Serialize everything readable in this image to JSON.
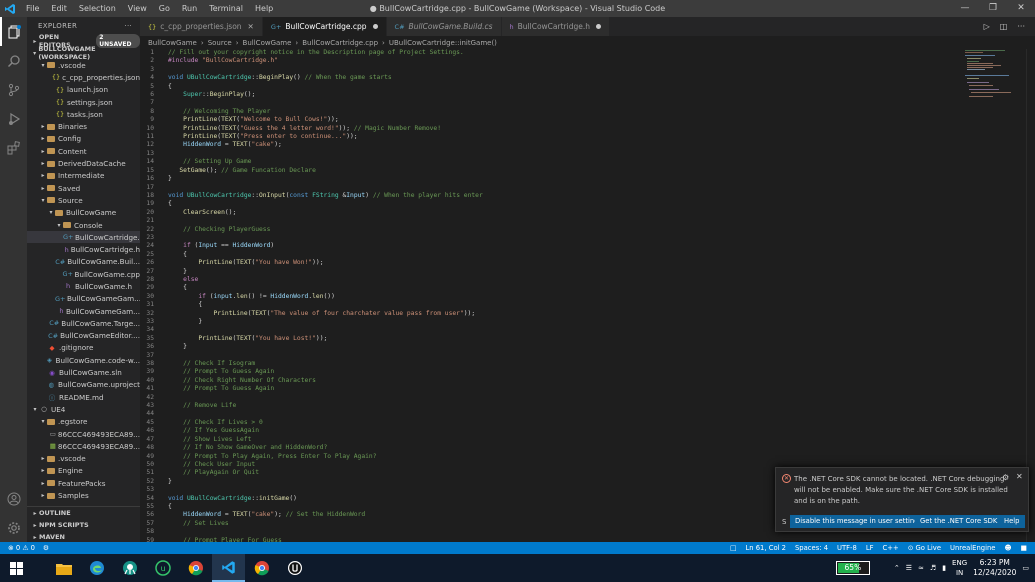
{
  "titlebar": {
    "menu": [
      "File",
      "Edit",
      "Selection",
      "View",
      "Go",
      "Run",
      "Terminal",
      "Help"
    ],
    "title": "● BullCowCartridge.cpp - BullCowGame (Workspace) - Visual Studio Code"
  },
  "sidebar": {
    "header": "EXPLORER",
    "open_editors": "OPEN EDITORS",
    "unsaved": "2 UNSAVED",
    "workspace": "BULLCOWGAME (WORKSPACE)",
    "outline": "OUTLINE",
    "npm": "NPM SCRIPTS",
    "maven": "MAVEN",
    "tree": [
      {
        "label": ".vscode",
        "depth": 1,
        "type": "folder",
        "open": true
      },
      {
        "label": "c_cpp_properties.json",
        "depth": 2,
        "type": "json"
      },
      {
        "label": "launch.json",
        "depth": 2,
        "type": "json"
      },
      {
        "label": "settings.json",
        "depth": 2,
        "type": "json"
      },
      {
        "label": "tasks.json",
        "depth": 2,
        "type": "json"
      },
      {
        "label": "Binaries",
        "depth": 1,
        "type": "folder"
      },
      {
        "label": "Config",
        "depth": 1,
        "type": "folder"
      },
      {
        "label": "Content",
        "depth": 1,
        "type": "folder"
      },
      {
        "label": "DerivedDataCache",
        "depth": 1,
        "type": "folder"
      },
      {
        "label": "Intermediate",
        "depth": 1,
        "type": "folder"
      },
      {
        "label": "Saved",
        "depth": 1,
        "type": "folder"
      },
      {
        "label": "Source",
        "depth": 1,
        "type": "folder",
        "open": true
      },
      {
        "label": "BullCowGame",
        "depth": 2,
        "type": "folder",
        "open": true
      },
      {
        "label": "Console",
        "depth": 3,
        "type": "folder",
        "open": true
      },
      {
        "label": "BullCowCartridge.c...",
        "depth": 4,
        "type": "cpp",
        "selected": true
      },
      {
        "label": "BullCowCartridge.h",
        "depth": 4,
        "type": "h"
      },
      {
        "label": "BullCowGame.Buil...",
        "depth": 3,
        "type": "cs"
      },
      {
        "label": "BullCowGame.cpp",
        "depth": 3,
        "type": "cpp"
      },
      {
        "label": "BullCowGame.h",
        "depth": 3,
        "type": "h"
      },
      {
        "label": "BullCowGameGam...",
        "depth": 3,
        "type": "cpp"
      },
      {
        "label": "BullCowGameGam...",
        "depth": 3,
        "type": "h"
      },
      {
        "label": "BullCowGame.Targe...",
        "depth": 2,
        "type": "cs"
      },
      {
        "label": "BullCowGameEditor....",
        "depth": 2,
        "type": "cs"
      },
      {
        "label": ".gitignore",
        "depth": 1,
        "type": "git"
      },
      {
        "label": "BullCowGame.code-w...",
        "depth": 1,
        "type": "ws"
      },
      {
        "label": "BullCowGame.sln",
        "depth": 1,
        "type": "sln"
      },
      {
        "label": "BullCowGame.uproject",
        "depth": 1,
        "type": "uproj"
      },
      {
        "label": "README.md",
        "depth": 1,
        "type": "md"
      },
      {
        "label": "UE4",
        "depth": 0,
        "type": "root",
        "open": true
      },
      {
        "label": ".egstore",
        "depth": 1,
        "type": "folder",
        "open": true
      },
      {
        "label": "86CCC469493ECA89...",
        "depth": 2,
        "type": "file"
      },
      {
        "label": "86CCC469493ECA89...",
        "depth": 2,
        "type": "filegreen"
      },
      {
        "label": ".vscode",
        "depth": 1,
        "type": "folder"
      },
      {
        "label": "Engine",
        "depth": 1,
        "type": "folder"
      },
      {
        "label": "FeaturePacks",
        "depth": 1,
        "type": "folder"
      },
      {
        "label": "Samples",
        "depth": 1,
        "type": "folder"
      }
    ]
  },
  "tabs": [
    {
      "label": "c_cpp_properties.json",
      "icon": "{}",
      "icon_color": "#cbcb41",
      "state": "close"
    },
    {
      "label": "BullCowCartridge.cpp",
      "icon": "G+",
      "icon_color": "#519aba",
      "state": "dirty",
      "active": true
    },
    {
      "label": "BullCowGame.Build.cs",
      "icon": "C#",
      "icon_color": "#519aba",
      "state": "none",
      "italic": true
    },
    {
      "label": "BullCowCartridge.h",
      "icon": "h",
      "icon_color": "#a074c4",
      "state": "dirty"
    }
  ],
  "breadcrumb": [
    "BullCowGame",
    "Source",
    "BullCowGame",
    "BullCowCartridge.cpp",
    "UBullCowCartridge::initGame()"
  ],
  "code": [
    [
      [
        "c-cm",
        "// Fill out your copyright notice in the Description page of Project Settings."
      ]
    ],
    [
      [
        "c-pp",
        "#include "
      ],
      [
        "c-st",
        "\"BullCowCartridge.h\""
      ]
    ],
    [],
    [
      [
        "c-kw",
        "void "
      ],
      [
        "c-ty",
        "UBullCowCartridge"
      ],
      [
        "",
        "::"
      ],
      [
        "c-fn",
        "BeginPlay"
      ],
      [
        "",
        "() "
      ],
      [
        "c-cm",
        "// When the game starts"
      ]
    ],
    [
      [
        "",
        "{"
      ]
    ],
    [
      [
        "",
        "    "
      ],
      [
        "c-ty",
        "Super"
      ],
      [
        "",
        "::"
      ],
      [
        "c-fn",
        "BeginPlay"
      ],
      [
        "",
        "();"
      ]
    ],
    [],
    [
      [
        "",
        "    "
      ],
      [
        "c-cm",
        "// Welcoming The Player"
      ]
    ],
    [
      [
        "",
        "    "
      ],
      [
        "c-fn",
        "PrintLine"
      ],
      [
        "",
        "("
      ],
      [
        "c-fn",
        "TEXT"
      ],
      [
        "",
        "("
      ],
      [
        "c-st",
        "\"Welcome to Bull Cows!\""
      ],
      [
        "",
        "));"
      ]
    ],
    [
      [
        "",
        "    "
      ],
      [
        "c-fn",
        "PrintLine"
      ],
      [
        "",
        "("
      ],
      [
        "c-fn",
        "TEXT"
      ],
      [
        "",
        "("
      ],
      [
        "c-st",
        "\"Guess the 4 letter word!\""
      ],
      [
        "",
        "));"
      ],
      [
        "c-cm",
        " // Magic Number Remove!"
      ]
    ],
    [
      [
        "",
        "    "
      ],
      [
        "c-fn",
        "PrintLine"
      ],
      [
        "",
        "("
      ],
      [
        "c-fn",
        "TEXT"
      ],
      [
        "",
        "("
      ],
      [
        "c-st",
        "\"Press enter to continue...\""
      ],
      [
        "",
        "));"
      ]
    ],
    [
      [
        "",
        "    "
      ],
      [
        "c-var",
        "HiddenWord"
      ],
      [
        "",
        " = "
      ],
      [
        "c-fn",
        "TEXT"
      ],
      [
        "",
        "("
      ],
      [
        "c-st",
        "\"cake\""
      ],
      [
        "",
        ");"
      ]
    ],
    [],
    [
      [
        "",
        "    "
      ],
      [
        "c-cm",
        "// Setting Up Game"
      ]
    ],
    [
      [
        "",
        "   "
      ],
      [
        "c-fn",
        "SetGame"
      ],
      [
        "",
        "(); "
      ],
      [
        "c-cm",
        "// Game Funcation Declare"
      ]
    ],
    [
      [
        "",
        "}"
      ]
    ],
    [],
    [
      [
        "c-kw",
        "void "
      ],
      [
        "c-ty",
        "UBullCowCartridge"
      ],
      [
        "",
        "::"
      ],
      [
        "c-fn",
        "OnInput"
      ],
      [
        "",
        "("
      ],
      [
        "c-kw",
        "const "
      ],
      [
        "c-ty",
        "FString "
      ],
      [
        "",
        "&"
      ],
      [
        "c-var",
        "Input"
      ],
      [
        "",
        ") "
      ],
      [
        "c-cm",
        "// When the player hits enter"
      ]
    ],
    [
      [
        "",
        "{"
      ]
    ],
    [
      [
        "",
        "    "
      ],
      [
        "c-fn",
        "ClearScreen"
      ],
      [
        "",
        "();"
      ]
    ],
    [],
    [
      [
        "",
        "    "
      ],
      [
        "c-cm",
        "// Checking PlayerGuess"
      ]
    ],
    [],
    [
      [
        "",
        "    "
      ],
      [
        "c-pp",
        "if "
      ],
      [
        "",
        "("
      ],
      [
        "c-var",
        "Input"
      ],
      [
        "",
        " == "
      ],
      [
        "c-var",
        "HiddenWord"
      ],
      [
        "",
        ")"
      ]
    ],
    [
      [
        "",
        "    {"
      ]
    ],
    [
      [
        "",
        "        "
      ],
      [
        "c-fn",
        "PrintLine"
      ],
      [
        "",
        "("
      ],
      [
        "c-fn",
        "TEXT"
      ],
      [
        "",
        "("
      ],
      [
        "c-st",
        "\"You have Won!\""
      ],
      [
        "",
        "));"
      ]
    ],
    [
      [
        "",
        "    }"
      ]
    ],
    [
      [
        "",
        "    "
      ],
      [
        "c-pp",
        "else"
      ]
    ],
    [
      [
        "",
        "    {"
      ]
    ],
    [
      [
        "",
        "        "
      ],
      [
        "c-pp",
        "if "
      ],
      [
        "",
        "("
      ],
      [
        "c-var",
        "input"
      ],
      [
        "",
        "."
      ],
      [
        "c-fn",
        "len"
      ],
      [
        "",
        "() != "
      ],
      [
        "c-var",
        "HiddenWord"
      ],
      [
        "",
        "."
      ],
      [
        "c-fn",
        "len"
      ],
      [
        "",
        "())"
      ]
    ],
    [
      [
        "",
        "        {"
      ]
    ],
    [
      [
        "",
        "            "
      ],
      [
        "c-fn",
        "PrintLine"
      ],
      [
        "",
        "("
      ],
      [
        "c-fn",
        "TEXT"
      ],
      [
        "",
        "("
      ],
      [
        "c-st",
        "\"The value of four charchater value pass from user\""
      ],
      [
        "",
        "));"
      ]
    ],
    [
      [
        "",
        "        }"
      ]
    ],
    [],
    [
      [
        "",
        "        "
      ],
      [
        "c-fn",
        "PrintLine"
      ],
      [
        "",
        "("
      ],
      [
        "c-fn",
        "TEXT"
      ],
      [
        "",
        "("
      ],
      [
        "c-st",
        "\"You have Lost!\""
      ],
      [
        "",
        "));"
      ]
    ],
    [
      [
        "",
        "    }"
      ]
    ],
    [],
    [
      [
        "",
        "    "
      ],
      [
        "c-cm",
        "// Check If Isogram"
      ]
    ],
    [
      [
        "",
        "    "
      ],
      [
        "c-cm",
        "// Prompt To Guess Again"
      ]
    ],
    [
      [
        "",
        "    "
      ],
      [
        "c-cm",
        "// Check Right Number Of Characters"
      ]
    ],
    [
      [
        "",
        "    "
      ],
      [
        "c-cm",
        "// Prompt To Guess Again"
      ]
    ],
    [],
    [
      [
        "",
        "    "
      ],
      [
        "c-cm",
        "// Remove Life"
      ]
    ],
    [],
    [
      [
        "",
        "    "
      ],
      [
        "c-cm",
        "// Check If Lives > 0"
      ]
    ],
    [
      [
        "",
        "    "
      ],
      [
        "c-cm",
        "// If Yes GuessAgain"
      ]
    ],
    [
      [
        "",
        "    "
      ],
      [
        "c-cm",
        "// Show Lives Left"
      ]
    ],
    [
      [
        "",
        "    "
      ],
      [
        "c-cm",
        "// If No Show GameOver and HiddenWord?"
      ]
    ],
    [
      [
        "",
        "    "
      ],
      [
        "c-cm",
        "// Prompt To Play Again, Press Enter To Play Again?"
      ]
    ],
    [
      [
        "",
        "    "
      ],
      [
        "c-cm",
        "// Check User Input"
      ]
    ],
    [
      [
        "",
        "    "
      ],
      [
        "c-cm",
        "// PlayAgain Or Quit"
      ]
    ],
    [
      [
        "",
        "}"
      ]
    ],
    [],
    [
      [
        "c-kw",
        "void "
      ],
      [
        "c-ty",
        "UBullCowCartridge"
      ],
      [
        "",
        "::"
      ],
      [
        "c-fn",
        "initGame"
      ],
      [
        "",
        "()"
      ]
    ],
    [
      [
        "",
        "{"
      ]
    ],
    [
      [
        "",
        "    "
      ],
      [
        "c-var",
        "HiddenWord"
      ],
      [
        "",
        " = "
      ],
      [
        "c-fn",
        "TEXT"
      ],
      [
        "",
        "("
      ],
      [
        "c-st",
        "\"cake\""
      ],
      [
        "",
        "); "
      ],
      [
        "c-cm",
        "// Set the HiddenWord"
      ]
    ],
    [
      [
        "",
        "    "
      ],
      [
        "c-cm",
        "// Set Lives"
      ]
    ],
    [],
    [
      [
        "",
        "    "
      ],
      [
        "c-cm",
        "// Prompt Player For Guess"
      ]
    ]
  ],
  "notification": {
    "message": "The .NET Core SDK cannot be located. .NET Core debugging will not be enabled. Make sure the .NET Core SDK is installed and is on the path.",
    "source": "S",
    "btn_disable": "Disable this message in user settings",
    "btn_get": "Get the .NET Core SDK",
    "btn_help": "Help"
  },
  "statusbar": {
    "problems": "⊗ 0 ⚠ 0",
    "position": "Ln 61, Col 2",
    "spaces": "Spaces: 4",
    "encoding": "UTF-8",
    "eol": "LF",
    "language": "C++",
    "golive": "⊙ Go Live",
    "engine": "UnrealEngine"
  },
  "taskbar": {
    "battery_percent": "65%",
    "battery_level": 0.65,
    "lang_top": "ENG",
    "lang_bottom": "IN",
    "time": "6:23 PM",
    "date": "12/24/2020"
  },
  "colors": {
    "accent": "#007acc",
    "titlebar": "#3c3c3c",
    "editor_bg": "#1e1e1e",
    "sidebar_bg": "#252526"
  }
}
